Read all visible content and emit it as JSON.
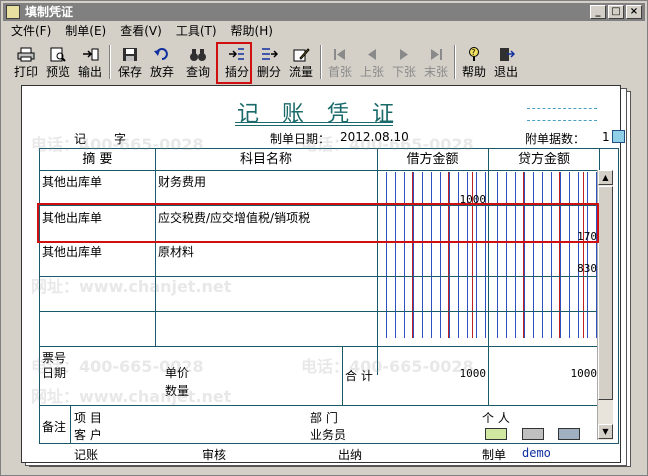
{
  "window": {
    "title": "填制凭证"
  },
  "title_buttons": {
    "minimize": "_",
    "maximize": "□",
    "close": "×"
  },
  "menu": [
    "文件(F)",
    "制单(E)",
    "查看(V)",
    "工具(T)",
    "帮助(H)"
  ],
  "toolbar": {
    "print": "打印",
    "preview": "预览",
    "export": "输出",
    "save": "保存",
    "abandon": "放弃",
    "query": "查询",
    "insert": "插分",
    "delete": "删分",
    "cashflow": "流量",
    "first": "首张",
    "prev": "上张",
    "next": "下张",
    "last": "末张",
    "help": "帮助",
    "exit": "退出"
  },
  "voucher": {
    "title": "记 账 凭 证",
    "type_label": "记",
    "zi": "字",
    "date_label": "制单日期：",
    "date": "2012.08.10",
    "attach_label": "附单据数：",
    "attach_count": "1",
    "headers": {
      "summary": "摘 要",
      "account": "科目名称",
      "debit": "借方金额",
      "credit": "贷方金额"
    },
    "rows": [
      {
        "summary": "其他出库单",
        "account": "财务费用",
        "debit": "1000",
        "credit": ""
      },
      {
        "summary": "其他出库单",
        "account": "应交税费/应交增值税/销项税",
        "debit": "",
        "credit": "170"
      },
      {
        "summary": "其他出库单",
        "account": "原材料",
        "debit": "",
        "credit": "830"
      },
      {
        "summary": "",
        "account": "",
        "debit": "",
        "credit": ""
      }
    ],
    "bill_no_label": "票号",
    "date_row_label": "日期",
    "unit_price_label": "单价",
    "quantity_label": "数量",
    "total_label": "合 计",
    "total_debit": "1000",
    "total_credit": "1000",
    "remark_label": "备注",
    "project_label": "项 目",
    "customer_label": "客 户",
    "dept_label": "部 门",
    "salesman_label": "业务员",
    "person_label": "个 人"
  },
  "footer": {
    "bookkeeper": "记账",
    "reviewer": "审核",
    "cashier": "出纳",
    "maker_label": "制单",
    "maker": "demo"
  },
  "watermarks": [
    "电话：400-665-0028",
    "网址：www.chanjet.net"
  ]
}
